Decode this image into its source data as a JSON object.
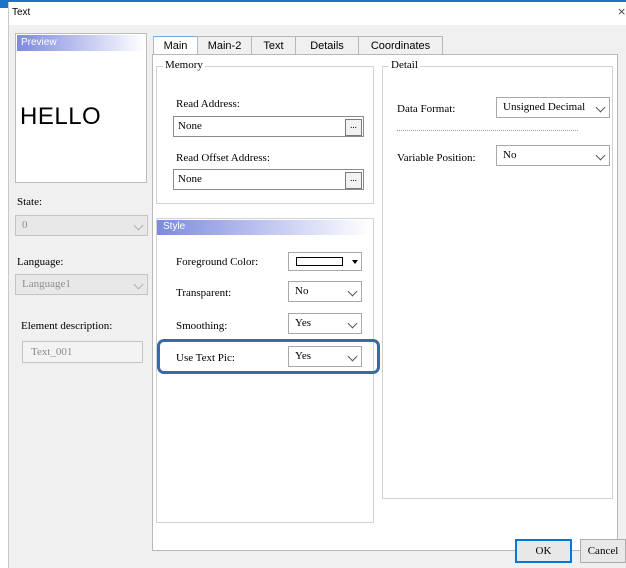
{
  "window": {
    "title": "Text",
    "close_label": "×"
  },
  "left_panel": {
    "preview_label": "Preview",
    "preview_text": "HELLO",
    "state_label": "State:",
    "state_value": "0",
    "language_label": "Language:",
    "language_value": "Language1",
    "description_label": "Element description:",
    "description_value": "Text_001"
  },
  "tabs": [
    {
      "label": "Main",
      "active": true
    },
    {
      "label": "Main-2",
      "active": false
    },
    {
      "label": "Text",
      "active": false
    },
    {
      "label": "Details",
      "active": false
    },
    {
      "label": "Coordinates",
      "active": false
    }
  ],
  "memory": {
    "title": "Memory",
    "read_address_label": "Read Address:",
    "read_address_value": "None",
    "read_offset_label": "Read Offset Address:",
    "read_offset_value": "None",
    "browse_label": "..."
  },
  "style": {
    "title": "Style",
    "foreground_label": "Foreground Color:",
    "foreground_color": "#ffffff",
    "transparent_label": "Transparent:",
    "transparent_value": "No",
    "smoothing_label": "Smoothing:",
    "smoothing_value": "Yes",
    "use_text_pic_label": "Use Text Pic:",
    "use_text_pic_value": "Yes",
    "highlight_color": "#3a6aa5"
  },
  "detail": {
    "title": "Detail",
    "data_format_label": "Data Format:",
    "data_format_value": "Unsigned Decimal",
    "variable_position_label": "Variable Position:",
    "variable_position_value": "No"
  },
  "buttons": {
    "ok": "OK",
    "cancel": "Cancel"
  }
}
